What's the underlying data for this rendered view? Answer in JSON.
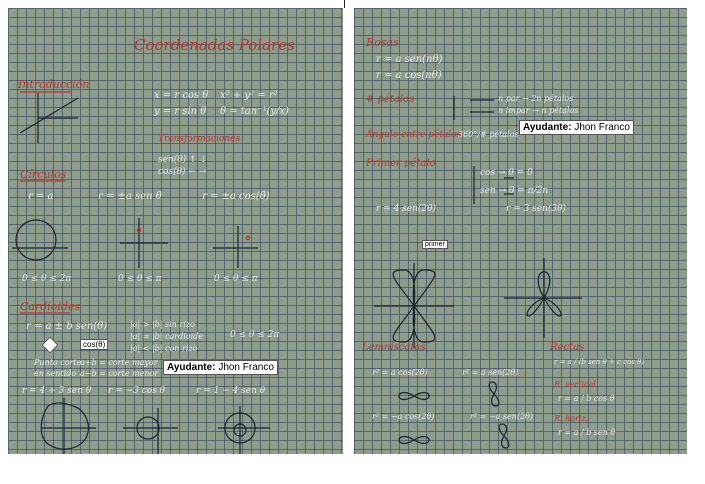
{
  "left_page": {
    "title": "Coordenadas Polares",
    "intro_heading": "Introducción",
    "intro_formulas": [
      "x = r cos θ",
      "x² + y² = r²",
      "y = r sin θ",
      "θ = tan⁻¹(y/x)"
    ],
    "transform_heading": "Transformaciones",
    "trig_items": [
      "sen(θ) ↑ ↓",
      "cos(θ) ← →"
    ],
    "circles_heading": "Círculos",
    "circle_eqs": [
      "r = a",
      "r = ±a sen θ",
      "r = ±a cos(θ)"
    ],
    "domains": [
      "0 ≤ θ ≤ 2π",
      "0 ≤ θ ≤ π",
      "0 ≤ θ ≤ π"
    ],
    "cardioids_heading": "Cardioides",
    "cardioid_formula": "r = a ± b sen(θ)",
    "conditions": [
      "|a| > |b| sin rizo",
      "|a| = |b| cardioide",
      "|a| < |b| con rizo"
    ],
    "domain_cardioid": "0 ≤ θ ≤ 2π",
    "cos_label": "cos(θ)",
    "ayudante_label": "Ayudante:",
    "ayudante_name": "Jhon Franco",
    "notes": [
      "Punto corte",
      "en sentido",
      "a+b = corte mayor",
      "a−b = corte menor"
    ],
    "bottom_eqs": [
      "r = 4 + 3 sen θ",
      "r = −3 cos θ",
      "r = 1 − 4 sen θ"
    ]
  },
  "right_page": {
    "roses_heading": "Rosas",
    "rose_eqs": [
      "r = a sen(nθ)",
      "r = a cos(nθ)"
    ],
    "petals_label": "# pétalos",
    "petals_rule": [
      "n par → 2n pétalos",
      "n impar → n pétalos"
    ],
    "angle_label": "Ángulo entre pétalos",
    "angle_value": "360°/# pétalos",
    "ayudante_label": "Ayudante:",
    "ayudante_name": "Jhon Franco",
    "first_petal_label": "Primer pétalo",
    "first_petal_rules": [
      "cos → θ = 0",
      "sen → θ = π/2n"
    ],
    "example_eqs": [
      "r = 4 sen(2θ)",
      "r = 3 sen(3θ)"
    ],
    "primer_label": "primer",
    "lemniscates_heading": "Lemniscatas",
    "lem_eqs": [
      "r² = a cos(2θ)",
      "r² = a sen(2θ)",
      "r² = −a cos(2θ)",
      "r² = −a sen(2θ)"
    ],
    "rectas_heading": "Rectas",
    "recta_eq": "r = a / (b sen θ + c cos θ)",
    "vertical_label": "R. vertical",
    "vertical_eq": "r = a / b cos θ",
    "horizontal_label": "R. horiz.",
    "horizontal_eq": "r = a / b sen θ"
  }
}
